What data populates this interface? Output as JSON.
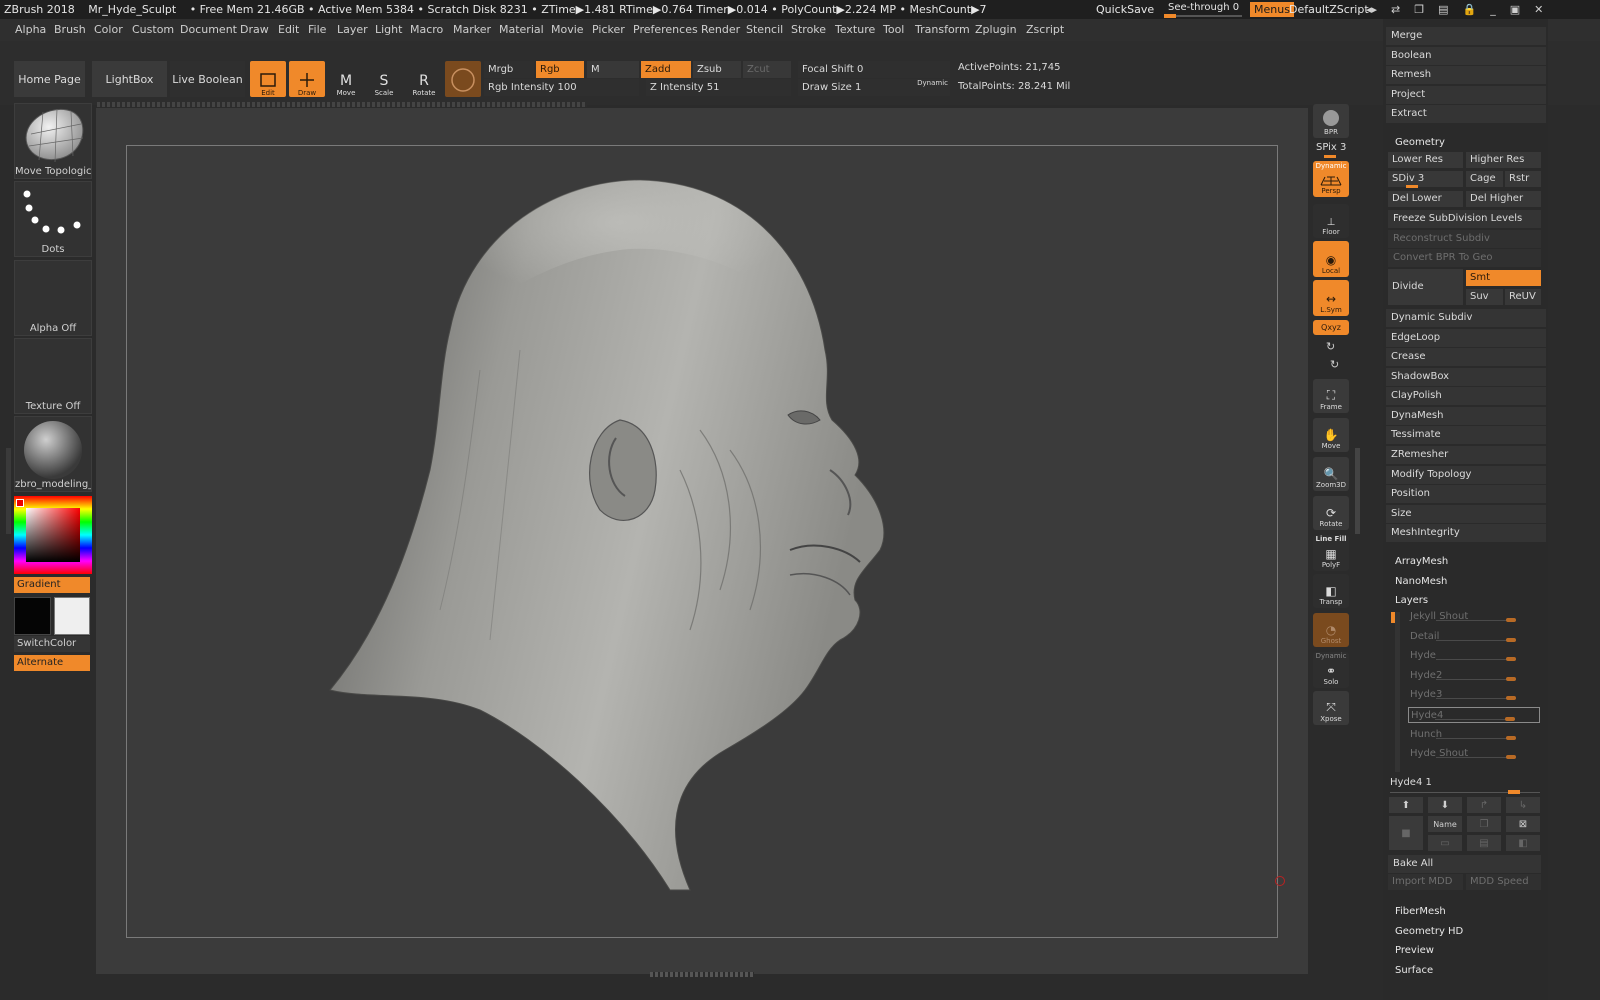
{
  "titlebar": {
    "app": "ZBrush 2018",
    "doc": "Mr_Hyde_Sculpt",
    "stats": "• Free Mem 21.46GB • Active Mem 5384 • Scratch Disk 8231 •  ZTime▶1.481 RTime▶0.764 Timer▶0.014 • PolyCount▶2.224 MP  • MeshCount▶7",
    "quicksave": "QuickSave",
    "seethrough": "See-through  0",
    "menus": "Menus",
    "script": "DefaultZScript"
  },
  "menubar": [
    "Alpha",
    "Brush",
    "Color",
    "Custom",
    "Document",
    "Draw",
    "Edit",
    "File",
    "Layer",
    "Light",
    "Macro",
    "Marker",
    "Material",
    "Movie",
    "Picker",
    "Preferences",
    "Render",
    "Stencil",
    "Stroke",
    "Texture",
    "Tool",
    "Transform",
    "Zplugin",
    "Zscript"
  ],
  "toolbar": {
    "home": "Home Page",
    "lightbox": "LightBox",
    "liveboolean": "Live Boolean",
    "edit": "Edit",
    "draw": "Draw",
    "move": "Move",
    "scale": "Scale",
    "rotate": "Rotate",
    "mrgb": "Mrgb",
    "rgb": "Rgb",
    "m": "M",
    "rgb_intensity": "Rgb Intensity 100",
    "zadd": "Zadd",
    "zsub": "Zsub",
    "zcut": "Zcut",
    "z_intensity": "Z Intensity 51",
    "focal_shift": "Focal Shift 0",
    "draw_size": "Draw Size 1",
    "dynamic": "Dynamic",
    "active_points": "ActivePoints: 21,745",
    "total_points": "TotalPoints: 28.241 Mil"
  },
  "left": {
    "brush": "Move Topologica",
    "stroke": "Dots",
    "alpha": "Alpha Off",
    "texture": "Texture Off",
    "material": "zbro_modeling_c",
    "gradient": "Gradient",
    "switchcolor": "SwitchColor",
    "alternate": "Alternate"
  },
  "rightshelf": {
    "bpr": "BPR",
    "spix": "SPix 3",
    "persp": "Persp",
    "persp_dyn": "Dynamic",
    "floor": "Floor",
    "local": "Local",
    "lsym": "L.Sym",
    "xyz": "Qxyz",
    "frame": "Frame",
    "move": "Move",
    "zoom3d": "Zoom3D",
    "rotate": "Rotate",
    "linefill": "Line Fill",
    "polyf": "PolyF",
    "transp": "Transp",
    "ghost": "Ghost",
    "solo_dyn": "Dynamic",
    "solo": "Solo",
    "xpose": "Xpose"
  },
  "subtool": [
    "Merge",
    "Boolean",
    "Remesh",
    "Project",
    "Extract"
  ],
  "geometry": {
    "header": "Geometry",
    "lower_res": "Lower Res",
    "higher_res": "Higher Res",
    "sdiv": "SDiv 3",
    "cage": "Cage",
    "rstr": "Rstr",
    "del_lower": "Del Lower",
    "del_higher": "Del Higher",
    "freeze": "Freeze SubDivision Levels",
    "reconstruct": "Reconstruct Subdiv",
    "convert": "Convert BPR To Geo",
    "divide": "Divide",
    "smt": "Smt",
    "suv": "Suv",
    "reuv": "ReUV",
    "items": [
      "Dynamic Subdiv",
      "EdgeLoop",
      "Crease",
      "ShadowBox",
      "ClayPolish",
      "DynaMesh",
      "Tessimate",
      "ZRemesher",
      "Modify Topology",
      "Position",
      "Size",
      "MeshIntegrity"
    ]
  },
  "arraymesh": "ArrayMesh",
  "nanomesh": "NanoMesh",
  "layers": {
    "header": "Layers",
    "items": [
      "Jekyll Shout",
      "Detail",
      "Hyde",
      "Hyde2",
      "Hyde3",
      "Hyde4",
      "Hunch",
      "Hyde Shout"
    ],
    "current": "Hyde4  1",
    "name": "Name",
    "bake_all": "Bake All",
    "import_mdd": "Import MDD",
    "mdd_speed": "MDD Speed"
  },
  "bottom": [
    "FiberMesh",
    "Geometry HD",
    "Preview",
    "Surface"
  ]
}
